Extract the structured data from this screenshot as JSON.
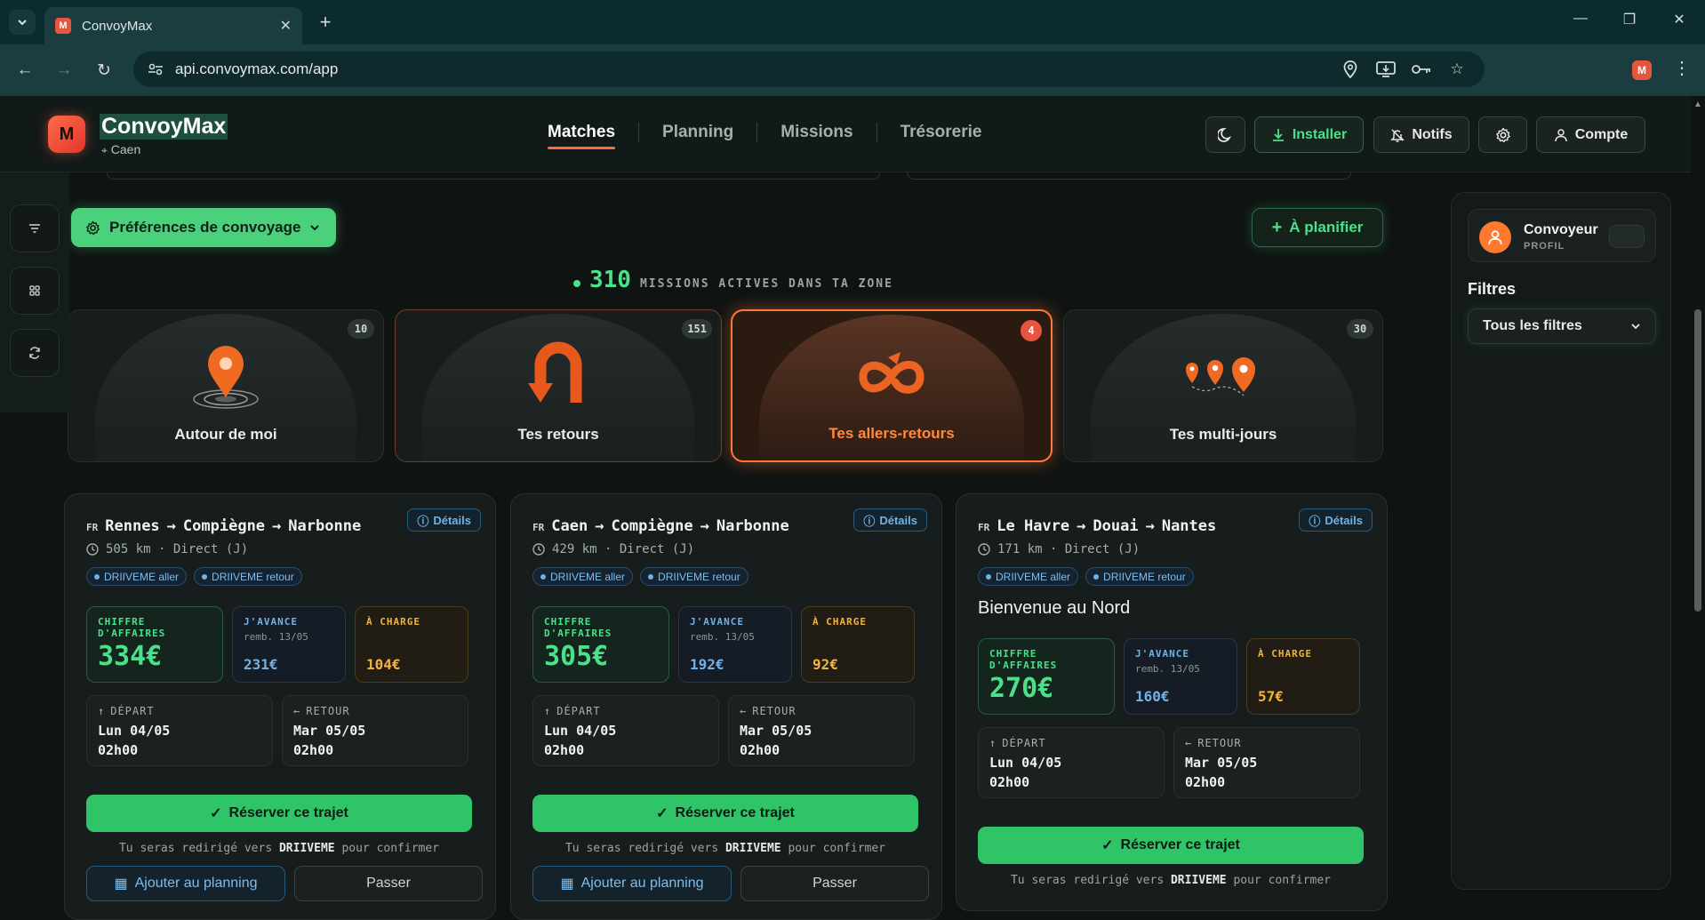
{
  "browser": {
    "tab_title": "ConvoyMax",
    "tab_favicon": "M",
    "url": "api.convoymax.com/app",
    "window_controls": [
      "—",
      "❐",
      "✕"
    ]
  },
  "header": {
    "logo_letter": "M",
    "brand": "ConvoyMax",
    "city": "Caen",
    "nav": [
      "Matches",
      "Planning",
      "Missions",
      "Trésorerie"
    ],
    "install": "Installer",
    "notifs": "Notifs",
    "account": "Compte"
  },
  "toolbar": {
    "preferences": "Préférences de convoyage",
    "to_plan": "À planifier"
  },
  "missions_count": {
    "value": "310",
    "label": "MISSIONS ACTIVES DANS TA ZONE"
  },
  "categories": [
    {
      "label": "Autour de moi",
      "count": "10"
    },
    {
      "label": "Tes retours",
      "count": "151"
    },
    {
      "label": "Tes allers-retours",
      "count": "4"
    },
    {
      "label": "Tes multi-jours",
      "count": "30"
    }
  ],
  "cards": [
    {
      "country": "FR",
      "route": [
        "Rennes",
        "→",
        "Compiègne",
        "→",
        "Narbonne"
      ],
      "details": "Détails",
      "distance": "505 km · Direct (J)",
      "tags": [
        "DRIIVEME aller",
        "DRIIVEME retour"
      ],
      "revenue_label": "CHIFFRE D'AFFAIRES",
      "revenue": "334€",
      "advance_label": "J'AVANCE",
      "advance_sub": "remb. 13/05",
      "advance": "231€",
      "charge_label": "À CHARGE",
      "charge": "104€",
      "depart_label": "DÉPART",
      "depart_day": "Lun 04/05",
      "depart_hour": "02h00",
      "retour_label": "RETOUR",
      "retour_day": "Mar 05/05",
      "retour_hour": "02h00",
      "reserve": "Réserver ce trajet",
      "redirect_pre": "Tu seras redirigé vers",
      "redirect_brand": "DRIIVEME",
      "redirect_post": "pour confirmer",
      "add_planning": "Ajouter au planning",
      "skip": "Passer"
    },
    {
      "country": "FR",
      "route": [
        "Caen",
        "→",
        "Compiègne",
        "→",
        "Narbonne"
      ],
      "details": "Détails",
      "distance": "429 km · Direct (J)",
      "tags": [
        "DRIIVEME aller",
        "DRIIVEME retour"
      ],
      "revenue_label": "CHIFFRE D'AFFAIRES",
      "revenue": "305€",
      "advance_label": "J'AVANCE",
      "advance_sub": "remb. 13/05",
      "advance": "192€",
      "charge_label": "À CHARGE",
      "charge": "92€",
      "depart_label": "DÉPART",
      "depart_day": "Lun 04/05",
      "depart_hour": "02h00",
      "retour_label": "RETOUR",
      "retour_day": "Mar 05/05",
      "retour_hour": "02h00",
      "reserve": "Réserver ce trajet",
      "redirect_pre": "Tu seras redirigé vers",
      "redirect_brand": "DRIIVEME",
      "redirect_post": "pour confirmer",
      "add_planning": "Ajouter au planning",
      "skip": "Passer"
    },
    {
      "country": "FR",
      "route": [
        "Le Havre",
        "→",
        "Douai",
        "→",
        "Nantes"
      ],
      "details": "Détails",
      "distance": "171 km · Direct (J)",
      "tags": [
        "DRIIVEME aller",
        "DRIIVEME retour"
      ],
      "welcome": "Bienvenue au Nord",
      "revenue_label": "CHIFFRE D'AFFAIRES",
      "revenue": "270€",
      "advance_label": "J'AVANCE",
      "advance_sub": "remb. 13/05",
      "advance": "160€",
      "charge_label": "À CHARGE",
      "charge": "57€",
      "depart_label": "DÉPART",
      "depart_day": "Lun 04/05",
      "depart_hour": "02h00",
      "retour_label": "RETOUR",
      "retour_day": "Mar 05/05",
      "retour_hour": "02h00",
      "reserve": "Réserver ce trajet",
      "redirect_pre": "Tu seras redirigé vers",
      "redirect_brand": "DRIIVEME",
      "redirect_post": "pour confirmer"
    }
  ],
  "right_panel": {
    "profile_name": "Convoyeur",
    "profile_role": "PROFIL",
    "filters_title": "Filtres",
    "filters_value": "Tous les filtres"
  },
  "colors": {
    "accent_green": "#4be08a",
    "accent_orange": "#ff7a3a",
    "accent_blue": "#6fb3e6",
    "accent_amber": "#f2b33d"
  }
}
